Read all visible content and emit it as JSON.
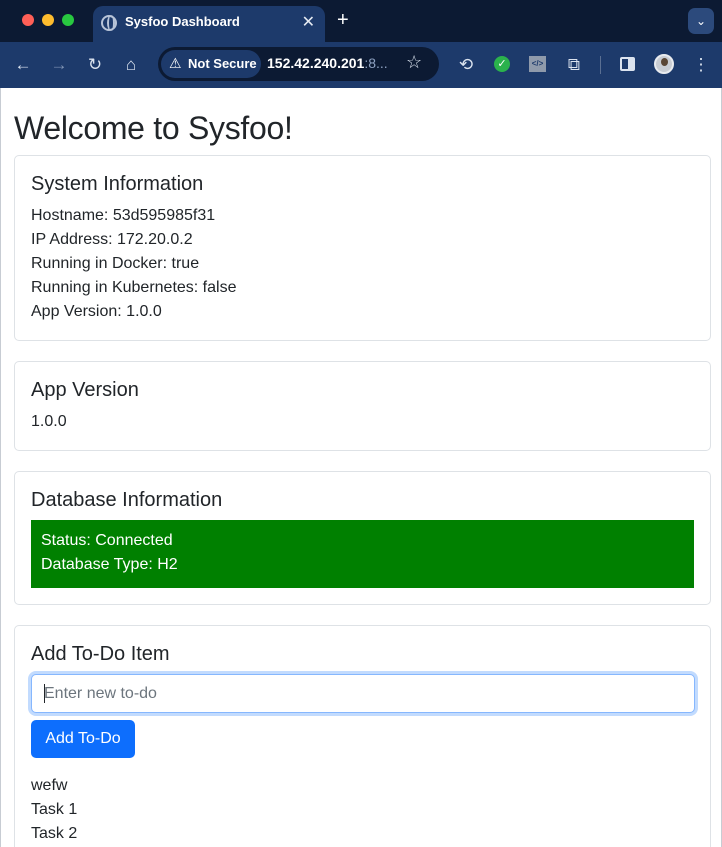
{
  "browser": {
    "tab_title": "Sysfoo Dashboard",
    "tab_close": "✕",
    "new_tab": "+",
    "security_label": "Not Secure",
    "url_main": "152.42.240.201",
    "url_dim": ":8...",
    "icons": {
      "back": "back-arrow-icon",
      "forward": "forward-arrow-icon",
      "reload": "reload-icon",
      "home": "home-icon",
      "warning": "warning-icon",
      "star": "star-icon",
      "menu": "kebab-menu-icon"
    },
    "colors": {
      "chrome_dark": "#0c1a33",
      "chrome": "#1d3a6b"
    }
  },
  "page": {
    "title": "Welcome to Sysfoo!",
    "system": {
      "heading": "System Information",
      "hostname": "Hostname: 53d595985f31",
      "ip": "IP Address: 172.20.0.2",
      "docker": "Running in Docker: true",
      "kubernetes": "Running in Kubernetes: false",
      "version": "App Version: 1.0.0"
    },
    "app_version": {
      "heading": "App Version",
      "value": "1.0.0"
    },
    "database": {
      "heading": "Database Information",
      "status": "Status: Connected",
      "type": "Database Type: H2",
      "status_color": "#008000"
    },
    "todo": {
      "heading": "Add To-Do Item",
      "input_placeholder": "Enter new to-do",
      "input_value": "",
      "add_label": "Add To-Do",
      "items": [
        "wefw",
        "Task 1",
        "Task 2"
      ],
      "button_color": "#0d6efd"
    }
  }
}
